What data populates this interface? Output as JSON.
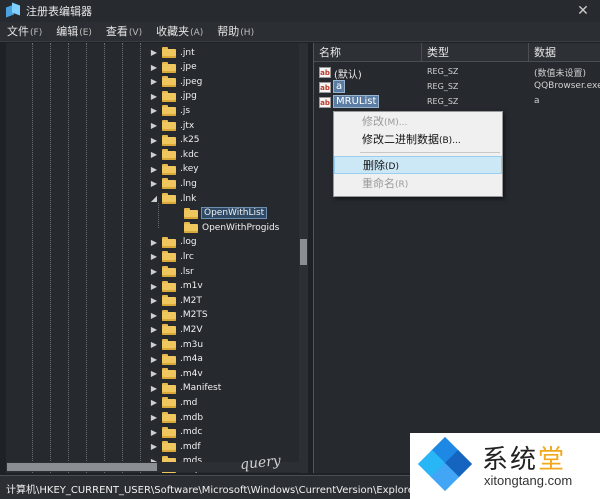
{
  "window": {
    "title": "注册表编辑器",
    "close_glyph": "✕"
  },
  "menu": [
    {
      "label": "文件",
      "accel": "(F)"
    },
    {
      "label": "编辑",
      "accel": "(E)"
    },
    {
      "label": "查看",
      "accel": "(V)"
    },
    {
      "label": "收藏夹",
      "accel": "(A)"
    },
    {
      "label": "帮助",
      "accel": "(H)"
    }
  ],
  "tree": {
    "items": [
      {
        "label": ".jnt",
        "expanded": false
      },
      {
        "label": ".jpe",
        "expanded": false
      },
      {
        "label": ".jpeg",
        "expanded": false
      },
      {
        "label": ".jpg",
        "expanded": false
      },
      {
        "label": ".js",
        "expanded": false
      },
      {
        "label": ".jtx",
        "expanded": false
      },
      {
        "label": ".k25",
        "expanded": false
      },
      {
        "label": ".kdc",
        "expanded": false
      },
      {
        "label": ".key",
        "expanded": false
      },
      {
        "label": ".lng",
        "expanded": false
      },
      {
        "label": ".lnk",
        "expanded": true
      },
      {
        "label": "OpenWithList",
        "child": true,
        "selected": true
      },
      {
        "label": "OpenWithProgids",
        "child": true
      },
      {
        "label": ".log",
        "expanded": false
      },
      {
        "label": ".lrc",
        "expanded": false
      },
      {
        "label": ".lsr",
        "expanded": false
      },
      {
        "label": ".m1v",
        "expanded": false
      },
      {
        "label": ".M2T",
        "expanded": false
      },
      {
        "label": ".M2TS",
        "expanded": false
      },
      {
        "label": ".M2V",
        "expanded": false
      },
      {
        "label": ".m3u",
        "expanded": false
      },
      {
        "label": ".m4a",
        "expanded": false
      },
      {
        "label": ".m4v",
        "expanded": false
      },
      {
        "label": ".Manifest",
        "expanded": false
      },
      {
        "label": ".md",
        "expanded": false
      },
      {
        "label": ".mdb",
        "expanded": false
      },
      {
        "label": ".mdc",
        "expanded": false
      },
      {
        "label": ".mdf",
        "expanded": false
      },
      {
        "label": ".mds",
        "expanded": false
      },
      {
        "label": ".mdx",
        "expanded": false
      }
    ]
  },
  "values_table": {
    "headers": {
      "name": "名称",
      "type": "类型",
      "data": "数据"
    },
    "rows": [
      {
        "name": "(默认)",
        "type": "REG_SZ",
        "data": "(数值未设置)",
        "highlight": false
      },
      {
        "name": "a",
        "type": "REG_SZ",
        "data": "QQBrowser.exe",
        "highlight": true
      },
      {
        "name": "MRUList",
        "type": "REG_SZ",
        "data": "a",
        "highlight": true
      }
    ],
    "value_icon": "ab"
  },
  "context_menu": {
    "items": [
      {
        "label": "修改",
        "accel": "(M)...",
        "disabled": true
      },
      {
        "label": "修改二进制数据",
        "accel": "(B)...",
        "disabled": false
      },
      {
        "label": "删除",
        "accel": "(D)",
        "disabled": false,
        "active": true
      },
      {
        "label": "重命名",
        "accel": "(R)",
        "disabled": true
      }
    ]
  },
  "status": {
    "path": "计算机\\HKEY_CURRENT_USER\\Software\\Microsoft\\Windows\\CurrentVersion\\Explorer\\FileExts\\.lnk\\OpenWithList"
  },
  "watermark": {
    "title_a": "系统",
    "title_b": "堂",
    "url": "xitongtang.com"
  },
  "colors": {
    "accent_blue": "#1e88e5",
    "accent_orange": "#f2a81d",
    "selection": "#cce8f7"
  }
}
